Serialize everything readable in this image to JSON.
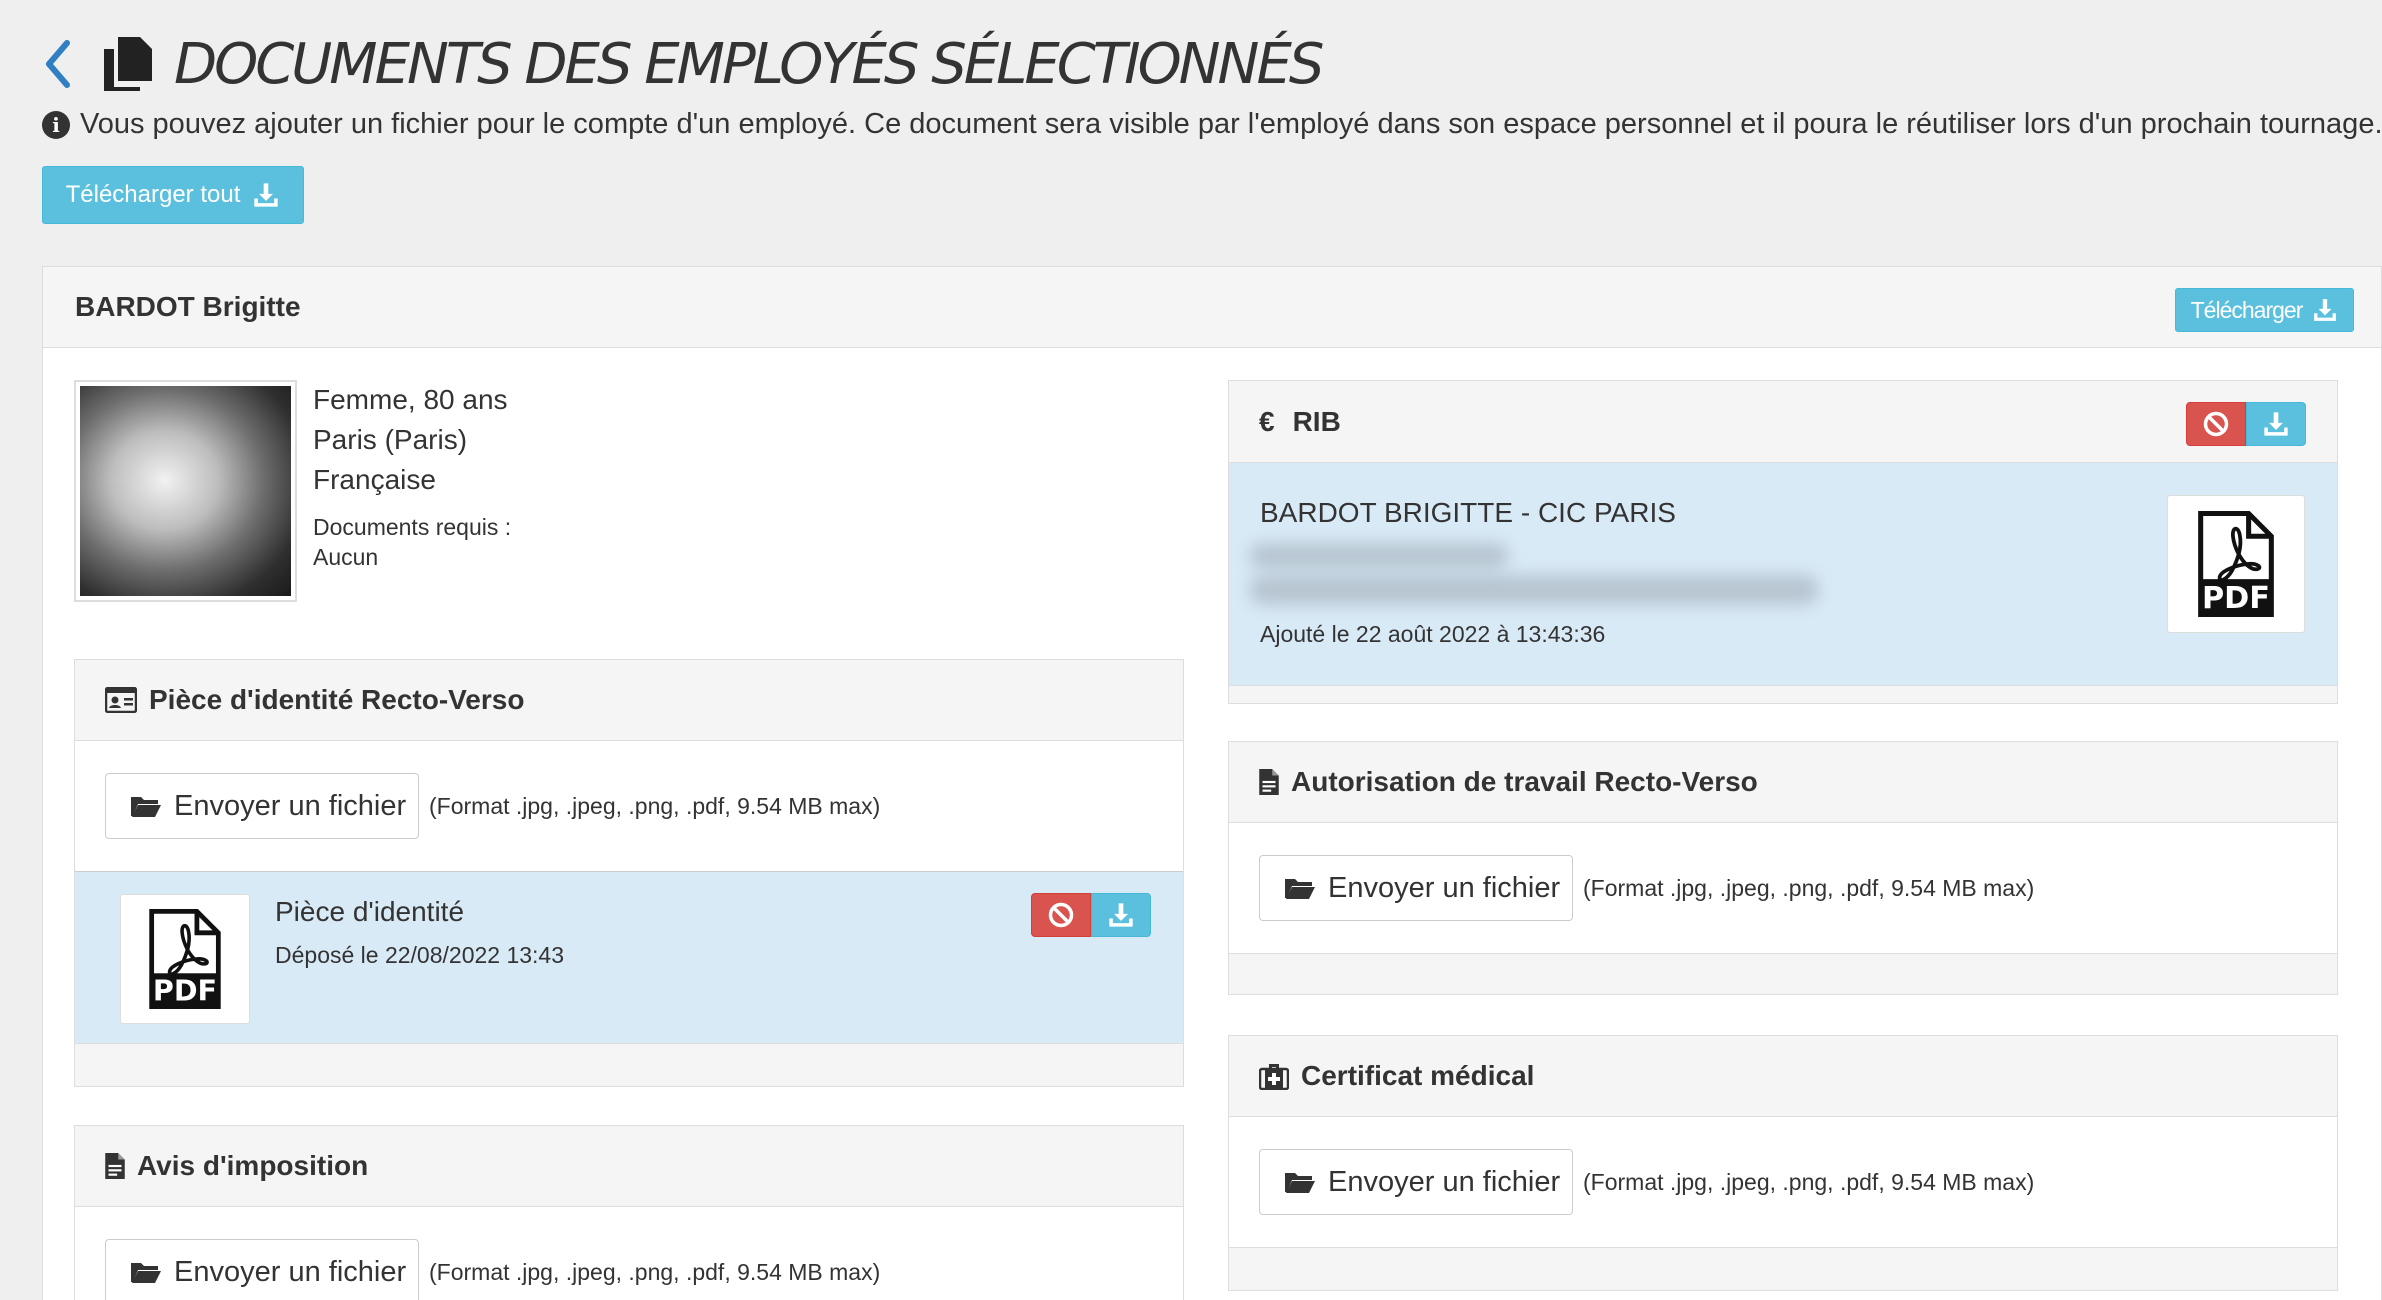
{
  "header": {
    "title": "DOCUMENTS DES EMPLOYÉS SÉLECTIONNÉS",
    "info_text": "Vous pouvez ajouter un fichier pour le compte d'un employé. Ce document sera visible par l'employé dans son espace personnel et il poura le réutiliser lors d'un prochain tournage.",
    "download_all_label": "Télécharger tout"
  },
  "employee": {
    "name": "BARDOT Brigitte",
    "download_label": "Télécharger",
    "gender_age": "Femme, 80 ans",
    "city": "Paris (Paris)",
    "nationality": "Française",
    "docs_required_label": "Documents requis :",
    "docs_required_value": "Aucun"
  },
  "panels": {
    "id": {
      "title": "Pièce d'identité Recto-Verso",
      "upload_label": "Envoyer un fichier",
      "format": "(Format .jpg, .jpeg, .png, .pdf, 9.54 MB max)",
      "file": {
        "name": "Pièce d'identité",
        "date": "Déposé le 22/08/2022 13:43",
        "badge": "PDF"
      }
    },
    "tax": {
      "title": "Avis d'imposition",
      "upload_label": "Envoyer un fichier",
      "format": "(Format .jpg, .jpeg, .png, .pdf, 9.54 MB max)"
    },
    "rib": {
      "title": "RIB",
      "currency_symbol": "€",
      "holder": "BARDOT BRIGITTE - CIC PARIS",
      "added": "Ajouté le 22 août 2022 à 13:43:36",
      "badge": "PDF"
    },
    "work": {
      "title": "Autorisation de travail Recto-Verso",
      "upload_label": "Envoyer un fichier",
      "format": "(Format .jpg, .jpeg, .png, .pdf, 9.54 MB max)"
    },
    "medical": {
      "title": "Certificat médical",
      "upload_label": "Envoyer un fichier",
      "format": "(Format .jpg, .jpeg, .png, .pdf, 9.54 MB max)"
    }
  },
  "colors": {
    "info": "#5bc0de",
    "danger": "#d9534f",
    "file_row": "#d9eaf7",
    "back_arrow": "#2f7fc2"
  },
  "icons": [
    "chevron-left-icon",
    "copy-icon",
    "info-icon",
    "download-icon",
    "id-card-icon",
    "file-icon",
    "euro-icon",
    "ban-icon",
    "folder-open-icon",
    "pdf-icon",
    "medkit-icon"
  ]
}
